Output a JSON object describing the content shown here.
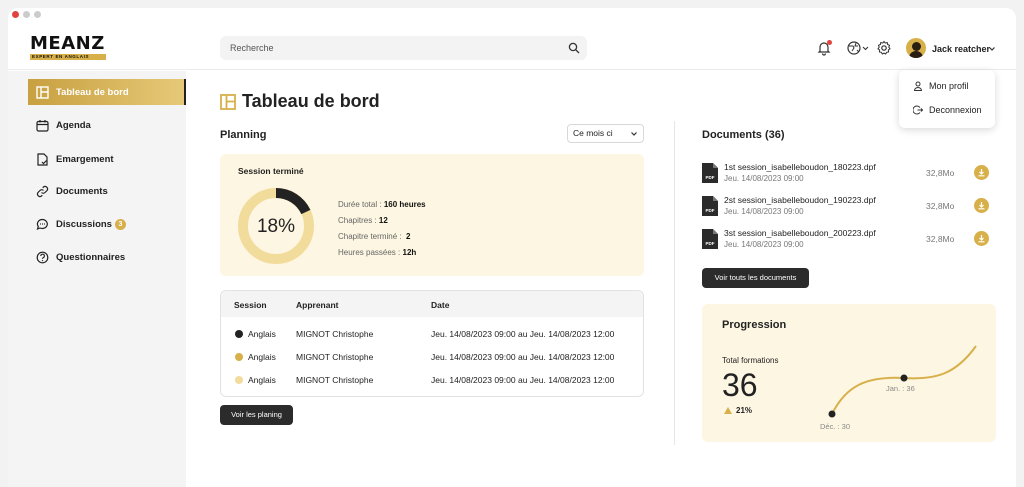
{
  "brand": {
    "name": "MEANZ",
    "tagline": "EXPERT EN ANGLAIS",
    "accent": "#d8b04a",
    "dark": "#2b2b2b",
    "soft": "#fdf6e2"
  },
  "header": {
    "search_placeholder": "Recherche",
    "user_name": "Jack reatcher",
    "icons": [
      "search-icon",
      "bell-icon",
      "globe-icon",
      "gear-icon",
      "chevron-down-icon"
    ]
  },
  "user_menu": {
    "items": [
      {
        "label": "Mon profil",
        "icon": "user-icon"
      },
      {
        "label": "Deconnexion",
        "icon": "logout-icon"
      }
    ]
  },
  "sidebar": {
    "items": [
      {
        "label": "Tableau de bord",
        "icon": "dashboard-icon",
        "active": true
      },
      {
        "label": "Agenda",
        "icon": "calendar-icon"
      },
      {
        "label": "Emargement",
        "icon": "signature-icon"
      },
      {
        "label": "Documents",
        "icon": "link-icon"
      },
      {
        "label": "Discussions",
        "icon": "chat-icon",
        "badge": "3"
      },
      {
        "label": "Questionnaires",
        "icon": "question-icon"
      }
    ]
  },
  "main": {
    "page_title": "Tableau de bord",
    "planning": {
      "title": "Planning",
      "period": "Ce mois ci",
      "session": {
        "title": "Session terminé",
        "percent": "18%",
        "progress": 0.18,
        "stats": [
          {
            "label": "Durée total :",
            "value": "160 heures"
          },
          {
            "label": "Chapitres :",
            "value": "12"
          },
          {
            "label": "Chapitre terminé :",
            "value": "2"
          },
          {
            "label": "Heures passées :",
            "value": "12h"
          }
        ]
      },
      "table": {
        "columns": [
          "Session",
          "Apprenant",
          "Date"
        ],
        "rows": [
          {
            "session": "Anglais",
            "learner": "MIGNOT Christophe",
            "date": "Jeu. 14/08/2023 09:00 au Jeu. 14/08/2023 12:00",
            "color": "#222222"
          },
          {
            "session": "Anglais",
            "learner": "MIGNOT Christophe",
            "date": "Jeu. 14/08/2023 09:00 au Jeu. 14/08/2023 12:00",
            "color": "#d8b04a"
          },
          {
            "session": "Anglais",
            "learner": "MIGNOT Christophe",
            "date": "Jeu. 14/08/2023 09:00 au Jeu. 14/08/2023 12:00",
            "color": "#f2dc9c"
          }
        ]
      },
      "button": "Voir les planing"
    },
    "documents": {
      "title": "Documents (36)",
      "items": [
        {
          "name": "1st session_isabelleboudon_180223.dpf",
          "date": "Jeu. 14/08/2023 09:00",
          "size": "32,8Mo"
        },
        {
          "name": "2st session_isabelleboudon_190223.dpf",
          "date": "Jeu. 14/08/2023 09:00",
          "size": "32,8Mo"
        },
        {
          "name": "3st session_isabelleboudon_200223.dpf",
          "date": "Jeu. 14/08/2023 09:00",
          "size": "32,8Mo"
        }
      ],
      "button": "Voir touts les documents"
    },
    "progression": {
      "title": "Progression",
      "label": "Total formations",
      "value": "36",
      "delta": "21%",
      "points": [
        {
          "label": "Déc. : 30"
        },
        {
          "label": "Jan. : 36"
        }
      ]
    }
  }
}
